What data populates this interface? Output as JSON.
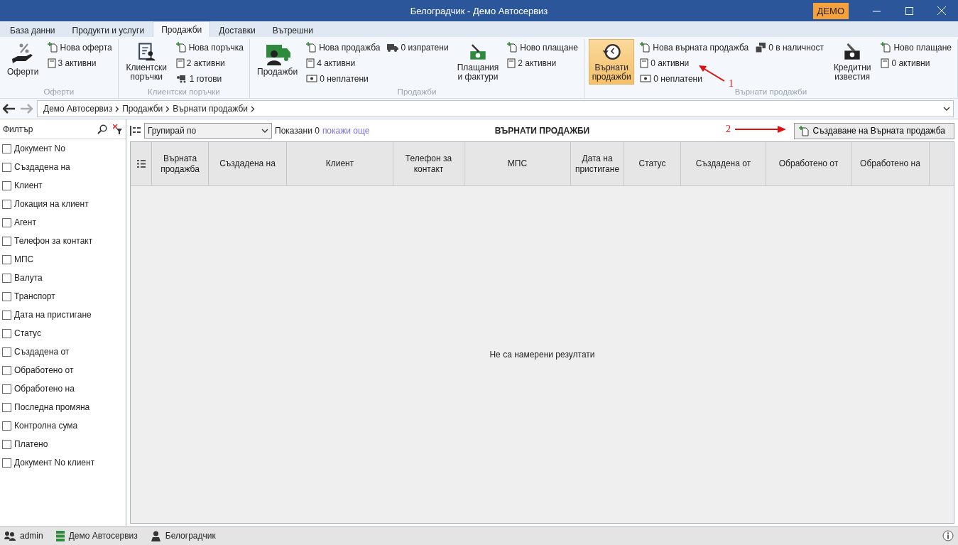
{
  "window": {
    "title": "Белоградчик - Демо Автосервиз",
    "badge": "ДЕМО"
  },
  "tabs": [
    {
      "label": "База данни",
      "selected": false
    },
    {
      "label": "Продукти и услуги",
      "selected": false
    },
    {
      "label": "Продажби",
      "selected": true
    },
    {
      "label": "Доставки",
      "selected": false
    },
    {
      "label": "Вътрешни",
      "selected": false
    }
  ],
  "ribbon_groups": [
    {
      "label": "Оферти",
      "sections": [
        {
          "kind": "big",
          "label": "Оферти",
          "selected": false
        },
        {
          "kind": "column",
          "items": [
            {
              "label": "Нова оферта"
            },
            {
              "label": "3 активни"
            }
          ]
        }
      ]
    },
    {
      "label": "Клиентски поръчки",
      "sections": [
        {
          "kind": "big",
          "label": "Клиентски поръчки",
          "selected": false
        },
        {
          "kind": "column",
          "items": [
            {
              "label": "Нова поръчка"
            },
            {
              "label": "2 активни"
            },
            {
              "label": "1 готови"
            }
          ]
        }
      ]
    },
    {
      "label": "Продажби",
      "sections": [
        {
          "kind": "big",
          "label": "Продажби",
          "selected": false
        },
        {
          "kind": "column",
          "items": [
            {
              "label": "Нова продажба"
            },
            {
              "label": "4 активни"
            },
            {
              "label": "0 неплатени"
            }
          ]
        },
        {
          "kind": "column",
          "items": [
            {
              "label": "0 изпратени"
            }
          ]
        },
        {
          "kind": "big",
          "label": "Плащания и фактури",
          "selected": false
        },
        {
          "kind": "column",
          "items": [
            {
              "label": "Ново плащане"
            },
            {
              "label": "2 активни"
            }
          ]
        }
      ]
    },
    {
      "label": "Върнати продажби",
      "sections": [
        {
          "kind": "big",
          "label": "Върнати продажби",
          "selected": true
        },
        {
          "kind": "column",
          "items": [
            {
              "label": "Нова върната продажба"
            },
            {
              "label": "0 активни"
            },
            {
              "label": "0 неплатени"
            }
          ]
        },
        {
          "kind": "column",
          "items": [
            {
              "label": "0 в наличност"
            }
          ]
        },
        {
          "kind": "big",
          "label": "Кредитни известия",
          "selected": false
        },
        {
          "kind": "column",
          "items": [
            {
              "label": "Ново плащане"
            },
            {
              "label": "0 активни"
            }
          ]
        }
      ]
    }
  ],
  "breadcrumb": [
    "Демо Автосервиз",
    "Продажби",
    "Върнати продажби"
  ],
  "filter": {
    "title": "Филтър",
    "items": [
      {
        "label": "Документ No",
        "checked": false
      },
      {
        "label": "Създадена на",
        "checked": false
      },
      {
        "label": "Клиент",
        "checked": false
      },
      {
        "label": "Локация на клиент",
        "checked": false
      },
      {
        "label": "Агент",
        "checked": false
      },
      {
        "label": "Телефон за контакт",
        "checked": false
      },
      {
        "label": "МПС",
        "checked": false
      },
      {
        "label": "Валута",
        "checked": false
      },
      {
        "label": "Транспорт",
        "checked": false
      },
      {
        "label": "Дата на пристигане",
        "checked": false
      },
      {
        "label": "Статус",
        "checked": false
      },
      {
        "label": "Създадена от",
        "checked": false
      },
      {
        "label": "Обработено от",
        "checked": false
      },
      {
        "label": "Обработено на",
        "checked": false
      },
      {
        "label": "Последна промяна",
        "checked": false
      },
      {
        "label": "Контролна сума",
        "checked": false
      },
      {
        "label": "Платено",
        "checked": false
      },
      {
        "label": "Документ No клиент",
        "checked": false
      }
    ]
  },
  "toolbar": {
    "group_by": "Групирай по",
    "shown": "Показани 0",
    "show_more": "покажи още",
    "title": "ВЪРНАТИ ПРОДАЖБИ",
    "create_button": "Създаване на Върната продажба"
  },
  "table": {
    "columns": [
      "Върната продажба",
      "Създадена на",
      "Клиент",
      "Телефон за контакт",
      "МПС",
      "Дата на пристигане",
      "Статус",
      "Създадена от",
      "Обработено от",
      "Обработено на"
    ],
    "empty_message": "Не са намерени резултати"
  },
  "annotations": [
    {
      "number": "1"
    },
    {
      "number": "2"
    }
  ],
  "status_bar": [
    "admin",
    "Демо Автосервиз",
    "Белоградчик"
  ]
}
